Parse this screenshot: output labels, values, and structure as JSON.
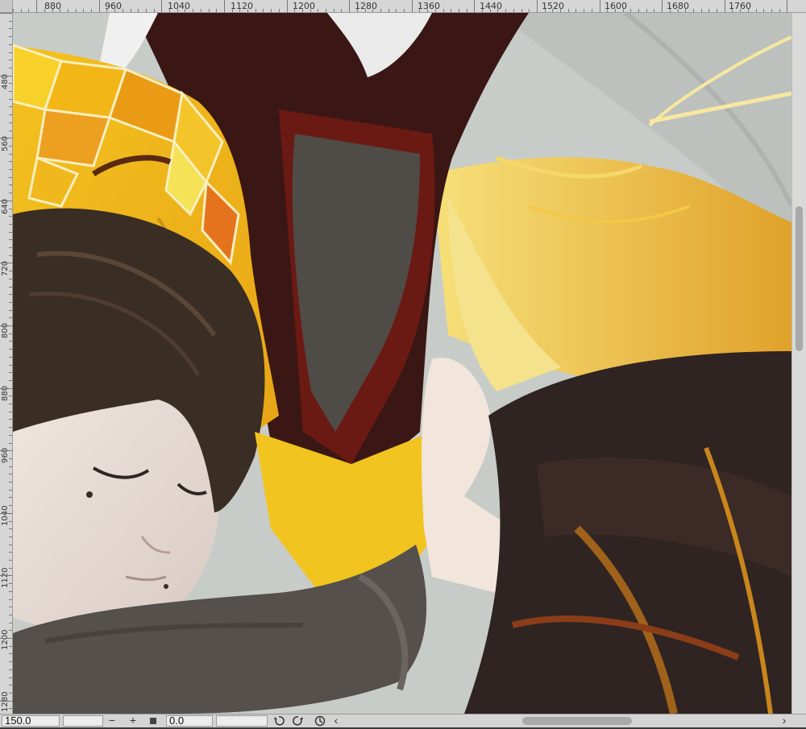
{
  "ruler": {
    "top_labels": [
      "880",
      "960",
      "1040",
      "1120",
      "1200",
      "1280",
      "1360",
      "1440",
      "1520",
      "1600",
      "1680",
      "1760"
    ],
    "left_labels": [
      "480",
      "560",
      "640",
      "720",
      "800",
      "880",
      "960",
      "1040",
      "1120",
      "1200",
      "1280"
    ]
  },
  "status": {
    "zoom_value": "150.0",
    "zoom_out_label": "−",
    "zoom_in_label": "+",
    "rotation_value": "0.0",
    "scroll_left_arrow": "‹",
    "scroll_right_arrow": "›"
  },
  "icons": {
    "fit": "square-icon",
    "rotate_left": "rotate-left-icon",
    "rotate_right": "rotate-right-icon",
    "reset_rotation": "reset-rotation-icon"
  },
  "colors": {
    "ruler_bg": "#d6d6d6",
    "statusbar_bg": "#d4d4d4",
    "canvas_bg": "#c9cdc9"
  }
}
